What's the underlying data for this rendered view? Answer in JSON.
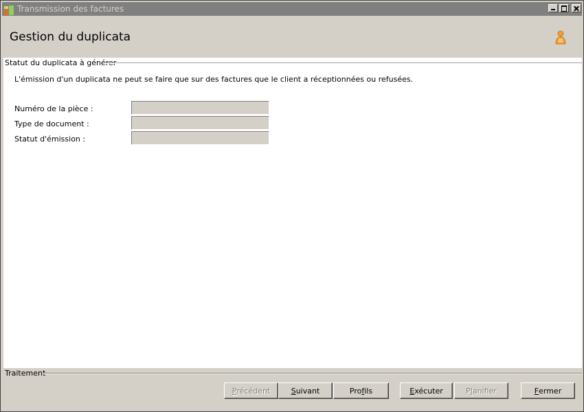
{
  "window": {
    "title": "Transmission des factures"
  },
  "header": {
    "title": "Gestion du duplicata"
  },
  "group": {
    "legend": "Statut du duplicata à générer",
    "info": "L'émission d'un duplicata ne peut se faire que sur des factures que le client a réceptionnées ou refusées.",
    "fields": [
      {
        "label": "Numéro de la pièce :",
        "value": ""
      },
      {
        "label": "Type de document :",
        "value": ""
      },
      {
        "label": "Statut d'émission :",
        "value": ""
      }
    ]
  },
  "footer": {
    "legend": "Traitement",
    "buttons": [
      {
        "key": "P",
        "rest": "récédent",
        "enabled": false
      },
      {
        "key": "S",
        "rest": "uivant",
        "enabled": true
      },
      {
        "pre": "Pro",
        "key": "f",
        "rest": "ils",
        "enabled": true
      },
      {
        "key": "E",
        "rest": "xécuter",
        "pre": "",
        "display": "Exécuter",
        "enabled": true
      },
      {
        "pre": "P",
        "key": "l",
        "rest": "anifier",
        "enabled": false
      },
      {
        "key": "F",
        "rest": "ermer",
        "enabled": true
      }
    ]
  },
  "colors": {
    "titlebar_bg": "#808080",
    "face": "#d4d0c8",
    "panel": "#ffffff",
    "user_icon": "#f0a030"
  },
  "icons": {
    "app": "app-logo-icon",
    "user": "user-icon"
  }
}
